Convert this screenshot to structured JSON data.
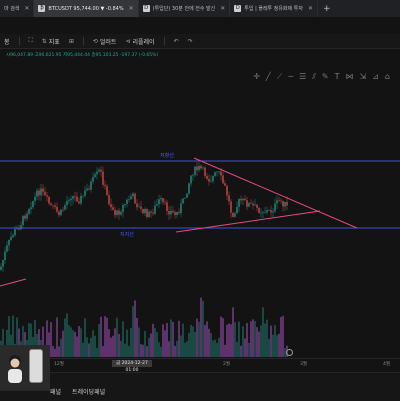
{
  "browser": {
    "tabs": [
      {
        "icon": "",
        "label": "마 검색",
        "active": false
      },
      {
        "icon": "₿",
        "label": "BTCUSDT 95,744.00 ▼ -0.84%",
        "active": true
      },
      {
        "icon": "D",
        "label": "(투입단) 30분 안에 전수 발신",
        "active": false
      },
      {
        "icon": "D",
        "label": "투입 | 플레투 정유화제 투자",
        "active": false
      }
    ],
    "new_tab": "+"
  },
  "toolbar": {
    "items": [
      {
        "icon": "",
        "label": "봉"
      },
      {
        "icon": "⛶",
        "label": ""
      },
      {
        "icon": "⇅",
        "label": "지표"
      },
      {
        "icon": "⊞",
        "label": ""
      },
      {
        "icon": "⟲",
        "label": "얼러트"
      },
      {
        "icon": "⊲",
        "label": "리플레이"
      },
      {
        "icon": "↶",
        "label": ""
      },
      {
        "icon": "↷",
        "label": ""
      }
    ]
  },
  "chart": {
    "ohlc_line": "시96,047.89 고96,621.95 저95,444.44 종95,103.25 -197.37 (-0.65%)",
    "resistance_label": "저항선",
    "support_label": "지지선",
    "x_ticks": [
      "12월",
      "2월",
      "3월",
      "4월"
    ],
    "highlight_date": "금 2024-12-27  01:00",
    "colors": {
      "up": "#26a69a",
      "down": "#ef5350",
      "level_line": "#3f51d9",
      "trend_line": "#e64a84",
      "volume_up": "#1e5f58",
      "volume_down": "#7e3f8f"
    }
  },
  "bottom_panel": {
    "label_left": "패널",
    "label_right": "트레이딩패널"
  },
  "drawing_tools": [
    "cursor",
    "line",
    "ray",
    "horizontal",
    "fib",
    "channel",
    "brush",
    "text",
    "pattern",
    "measure",
    "ruler",
    "magnet"
  ],
  "chart_data": {
    "type": "candlestick",
    "x_ticks": [
      "12월",
      "2월",
      "3월",
      "4월"
    ],
    "annotations": [
      "저항선",
      "지지선"
    ]
  }
}
